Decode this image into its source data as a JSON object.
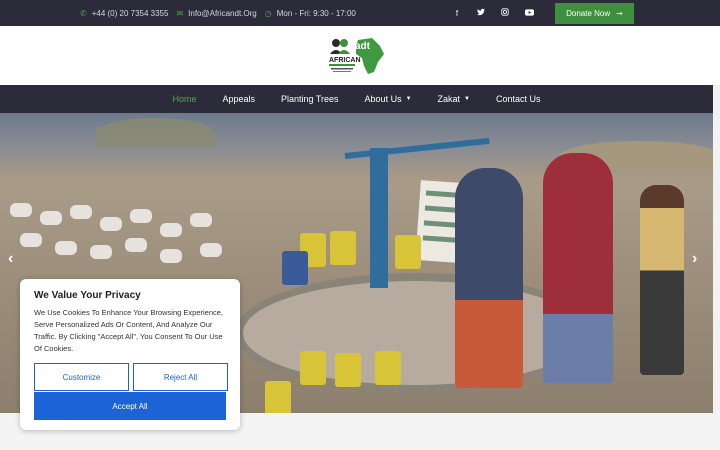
{
  "topbar": {
    "phone": "+44 (0) 20 7354 3355",
    "email": "Info@Africandt.Org",
    "hours": "Mon - Fri: 9:30 - 17:00",
    "social": [
      {
        "icon": "facebook-icon",
        "glyph": "f"
      },
      {
        "icon": "twitter-icon",
        "glyph": "🐦"
      },
      {
        "icon": "instagram-icon",
        "glyph": "◎"
      },
      {
        "icon": "youtube-icon",
        "glyph": "▶"
      }
    ],
    "donate_label": "Donate Now",
    "donate_arrow": "➞"
  },
  "logo": {
    "text": "adt",
    "subtitle": "AFRICAN"
  },
  "nav": {
    "items": [
      {
        "label": "Home",
        "active": true,
        "dropdown": false
      },
      {
        "label": "Appeals",
        "active": false,
        "dropdown": false
      },
      {
        "label": "Planting Trees",
        "active": false,
        "dropdown": false
      },
      {
        "label": "About Us",
        "active": false,
        "dropdown": true
      },
      {
        "label": "Zakat",
        "active": false,
        "dropdown": true
      },
      {
        "label": "Contact Us",
        "active": false,
        "dropdown": false
      }
    ]
  },
  "hero": {
    "prev_arrow": "‹",
    "next_arrow": "›",
    "sign_text": "DRILLING WELL IN SOUTHERN SOMALIA"
  },
  "cookie": {
    "title": "We Value Your Privacy",
    "body": "We Use Cookies To Enhance Your Browsing Experience, Serve Personalized Ads Or Content, And Analyze Our Traffic. By Clicking \"Accept All\", You Consent To Our Use Of Cookies.",
    "customize_label": "Customize",
    "reject_label": "Reject All",
    "accept_label": "Accept All"
  },
  "colors": {
    "dark_bar": "#2b2b3a",
    "green_accent": "#3f8f3f",
    "cookie_blue": "#1b63d6"
  }
}
